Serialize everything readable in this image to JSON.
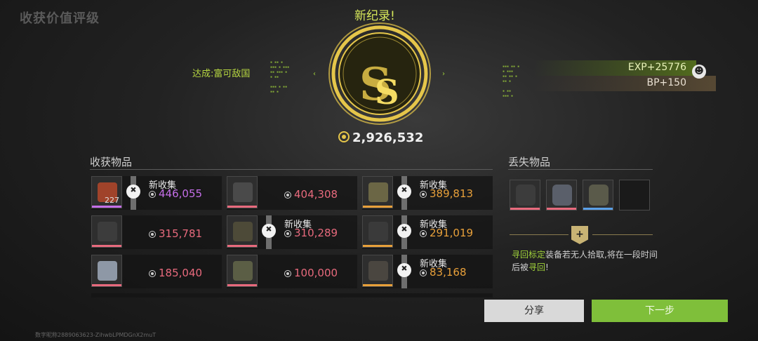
{
  "header": {
    "title": "收获价值评级",
    "record": "新纪录!"
  },
  "achievement": {
    "label": "达成:",
    "name": "富可敌国"
  },
  "rank": {
    "letter": "S",
    "total_value": "2,926,532"
  },
  "rewards": {
    "exp": "EXP+25776",
    "bp": "BP+150"
  },
  "collected": {
    "title": "收获物品",
    "items": [
      {
        "name": "item-1",
        "value": "446,055",
        "value_color": "#c46ee8",
        "stripe": "#c46ee8",
        "is_new": true,
        "new_label": "新收集",
        "qty": "227",
        "shape_color": "#a0432a"
      },
      {
        "name": "item-2",
        "value": "404,308",
        "value_color": "#e86a7d",
        "stripe": "#e86a7d",
        "is_new": false,
        "shape_color": "#4a4a4a"
      },
      {
        "name": "item-3",
        "value": "389,813",
        "value_color": "#e8a03a",
        "stripe": "#e8a03a",
        "is_new": true,
        "new_label": "新收集",
        "shape_color": "#6b6645"
      },
      {
        "name": "item-4",
        "value": "315,781",
        "value_color": "#e86a7d",
        "stripe": "#e86a7d",
        "is_new": false,
        "shape_color": "#3c3c3c"
      },
      {
        "name": "item-5",
        "value": "310,289",
        "value_color": "#e86a7d",
        "stripe": "#e86a7d",
        "is_new": true,
        "new_label": "新收集",
        "shape_color": "#4d4a38"
      },
      {
        "name": "item-6",
        "value": "291,019",
        "value_color": "#e8a03a",
        "stripe": "#e8a03a",
        "is_new": true,
        "new_label": "新收集",
        "shape_color": "#3a3a3a"
      },
      {
        "name": "item-7",
        "value": "185,040",
        "value_color": "#e86a7d",
        "stripe": "#e86a7d",
        "is_new": false,
        "shape_color": "#8e98a6"
      },
      {
        "name": "item-8",
        "value": "100,000",
        "value_color": "#e86a7d",
        "stripe": "#e86a7d",
        "is_new": false,
        "shape_color": "#5b5e45"
      },
      {
        "name": "item-9",
        "value": "83,168",
        "value_color": "#e8a03a",
        "stripe": "#e8a03a",
        "is_new": true,
        "new_label": "新收集",
        "shape_color": "#4a4640"
      }
    ]
  },
  "lost": {
    "title": "丢失物品",
    "items": [
      {
        "name": "lost-helmet",
        "stripe": "#e86a7d",
        "shape_color": "#3c3c3c"
      },
      {
        "name": "lost-armor",
        "stripe": "#e86a7d",
        "shape_color": "#5a5f6a"
      },
      {
        "name": "lost-backpack",
        "stripe": "#5aa0e8",
        "shape_color": "#5a5a4a"
      },
      {
        "name": "lost-empty",
        "stripe": "",
        "shape_color": ""
      }
    ]
  },
  "retrieve": {
    "badge": "+",
    "highlight1": "寻回标定",
    "text1": "装备若无人拾取,将在一段时间后被",
    "highlight2": "寻回",
    "text2": "!"
  },
  "buttons": {
    "share": "分享",
    "next": "下一步"
  },
  "footer": {
    "id_text": "数字昵称2889063623-ZihwbLPMDGnX2muT"
  },
  "colors": {
    "accent": "#9fd13a",
    "gold": "#e5c64a",
    "next_button": "#7fbf3a"
  }
}
